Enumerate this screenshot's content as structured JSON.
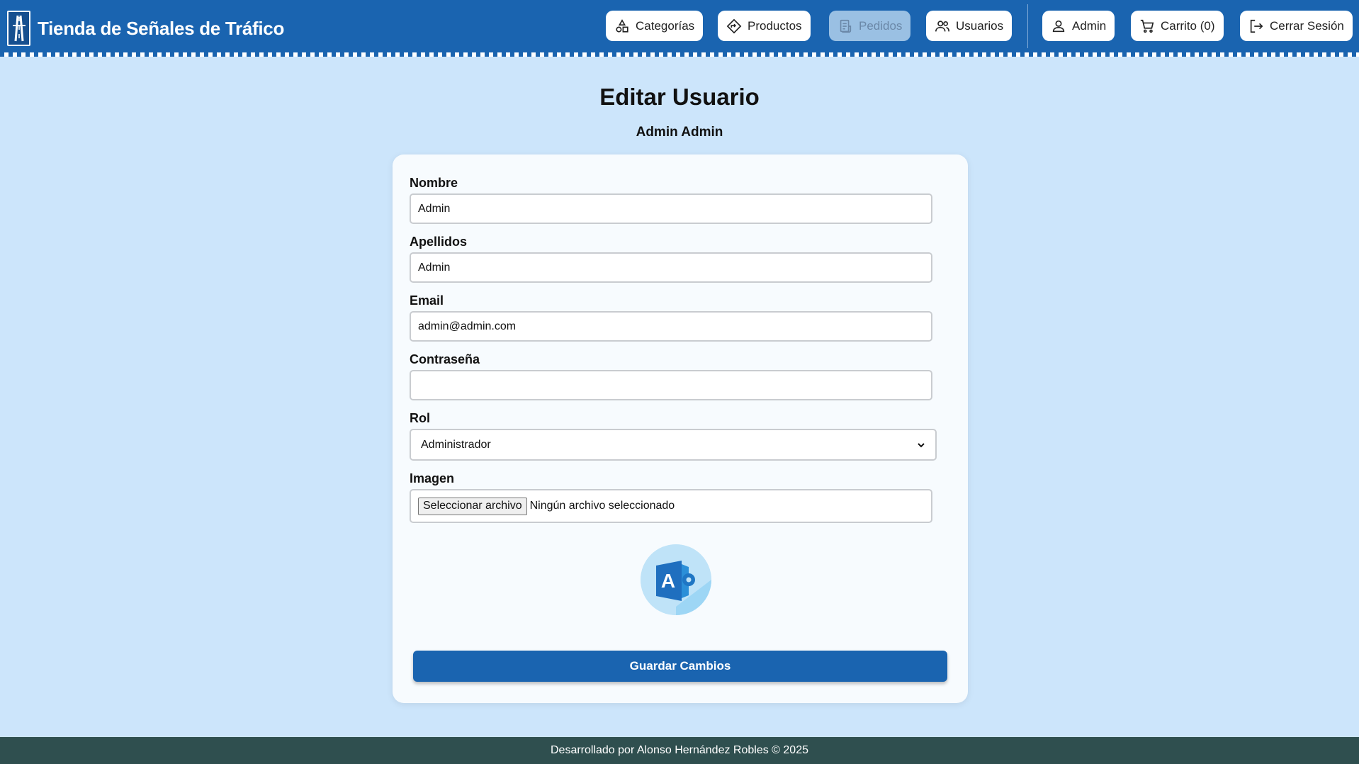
{
  "header": {
    "brand_title": "Tienda de Señales de Tráfico",
    "brand_icon": "highway-logo-icon",
    "nav": {
      "categorias": "Categorías",
      "productos": "Productos",
      "pedidos": "Pedidos",
      "usuarios": "Usuarios",
      "admin": "Admin",
      "carrito": "Carrito (0)",
      "cerrar_sesion": "Cerrar Sesión"
    }
  },
  "main": {
    "title": "Editar Usuario",
    "subtitle": "Admin Admin"
  },
  "form": {
    "nombre_label": "Nombre",
    "nombre_value": "Admin",
    "apellidos_label": "Apellidos",
    "apellidos_value": "Admin",
    "email_label": "Email",
    "email_value": "admin@admin.com",
    "password_label": "Contraseña",
    "password_value": "",
    "rol_label": "Rol",
    "rol_selected": "Administrador",
    "imagen_label": "Imagen",
    "file_button": "Seleccionar archivo",
    "file_status": "Ningún archivo seleccionado",
    "avatar_letter": "A",
    "save_label": "Guardar Cambios"
  },
  "footer": {
    "text": "Desarrollado por Alonso Hernández Robles © 2025"
  },
  "colors": {
    "header_bg": "#1a64b0",
    "page_bg": "#cce5fb",
    "footer_bg": "#2f4f4f",
    "primary_button": "#1a64b0"
  }
}
